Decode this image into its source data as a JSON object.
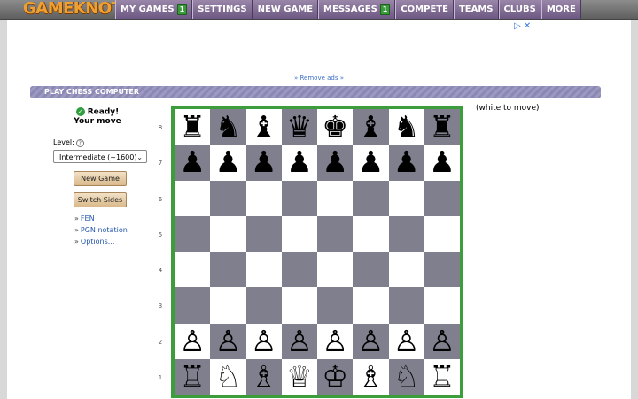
{
  "site": {
    "logo_text": "GAMEKNOT"
  },
  "nav": [
    {
      "label": "MY GAMES",
      "badge": "1"
    },
    {
      "label": "SETTINGS"
    },
    {
      "label": "NEW GAME"
    },
    {
      "label": "MESSAGES",
      "badge": "1"
    },
    {
      "label": "COMPETE"
    },
    {
      "label": "TEAMS"
    },
    {
      "label": "CLUBS"
    },
    {
      "label": "MORE"
    }
  ],
  "ad": {
    "close_glyph": "▷ ✕",
    "remove_ads": "» Remove ads »"
  },
  "section": {
    "title": "PLAY CHESS COMPUTER"
  },
  "status": {
    "line1": "Ready!",
    "line2": "Your move"
  },
  "level": {
    "label": "Level:",
    "help": "?",
    "selected": "Intermediate (~1600)"
  },
  "buttons": {
    "new_game": "New Game",
    "switch_sides": "Switch Sides"
  },
  "links": [
    "FEN",
    "PGN notation",
    "Options..."
  ],
  "turn_text": "(white to move)",
  "ranks": [
    "8",
    "7",
    "6",
    "5",
    "4",
    "3",
    "2",
    "1"
  ],
  "board": [
    [
      "♜",
      "♞",
      "♝",
      "♛",
      "♚",
      "♝",
      "♞",
      "♜"
    ],
    [
      "♟",
      "♟",
      "♟",
      "♟",
      "♟",
      "♟",
      "♟",
      "♟"
    ],
    [
      "",
      "",
      "",
      "",
      "",
      "",
      "",
      ""
    ],
    [
      "",
      "",
      "",
      "",
      "",
      "",
      "",
      ""
    ],
    [
      "",
      "",
      "",
      "",
      "",
      "",
      "",
      ""
    ],
    [
      "",
      "",
      "",
      "",
      "",
      "",
      "",
      ""
    ],
    [
      "♙",
      "♙",
      "♙",
      "♙",
      "♙",
      "♙",
      "♙",
      "♙"
    ],
    [
      "♖",
      "♘",
      "♗",
      "♕",
      "♔",
      "♗",
      "♘",
      "♖"
    ]
  ],
  "colors": {
    "light_square": "#ffffff",
    "dark_square": "#7f7f8d",
    "board_border": "#3b9e3b"
  }
}
